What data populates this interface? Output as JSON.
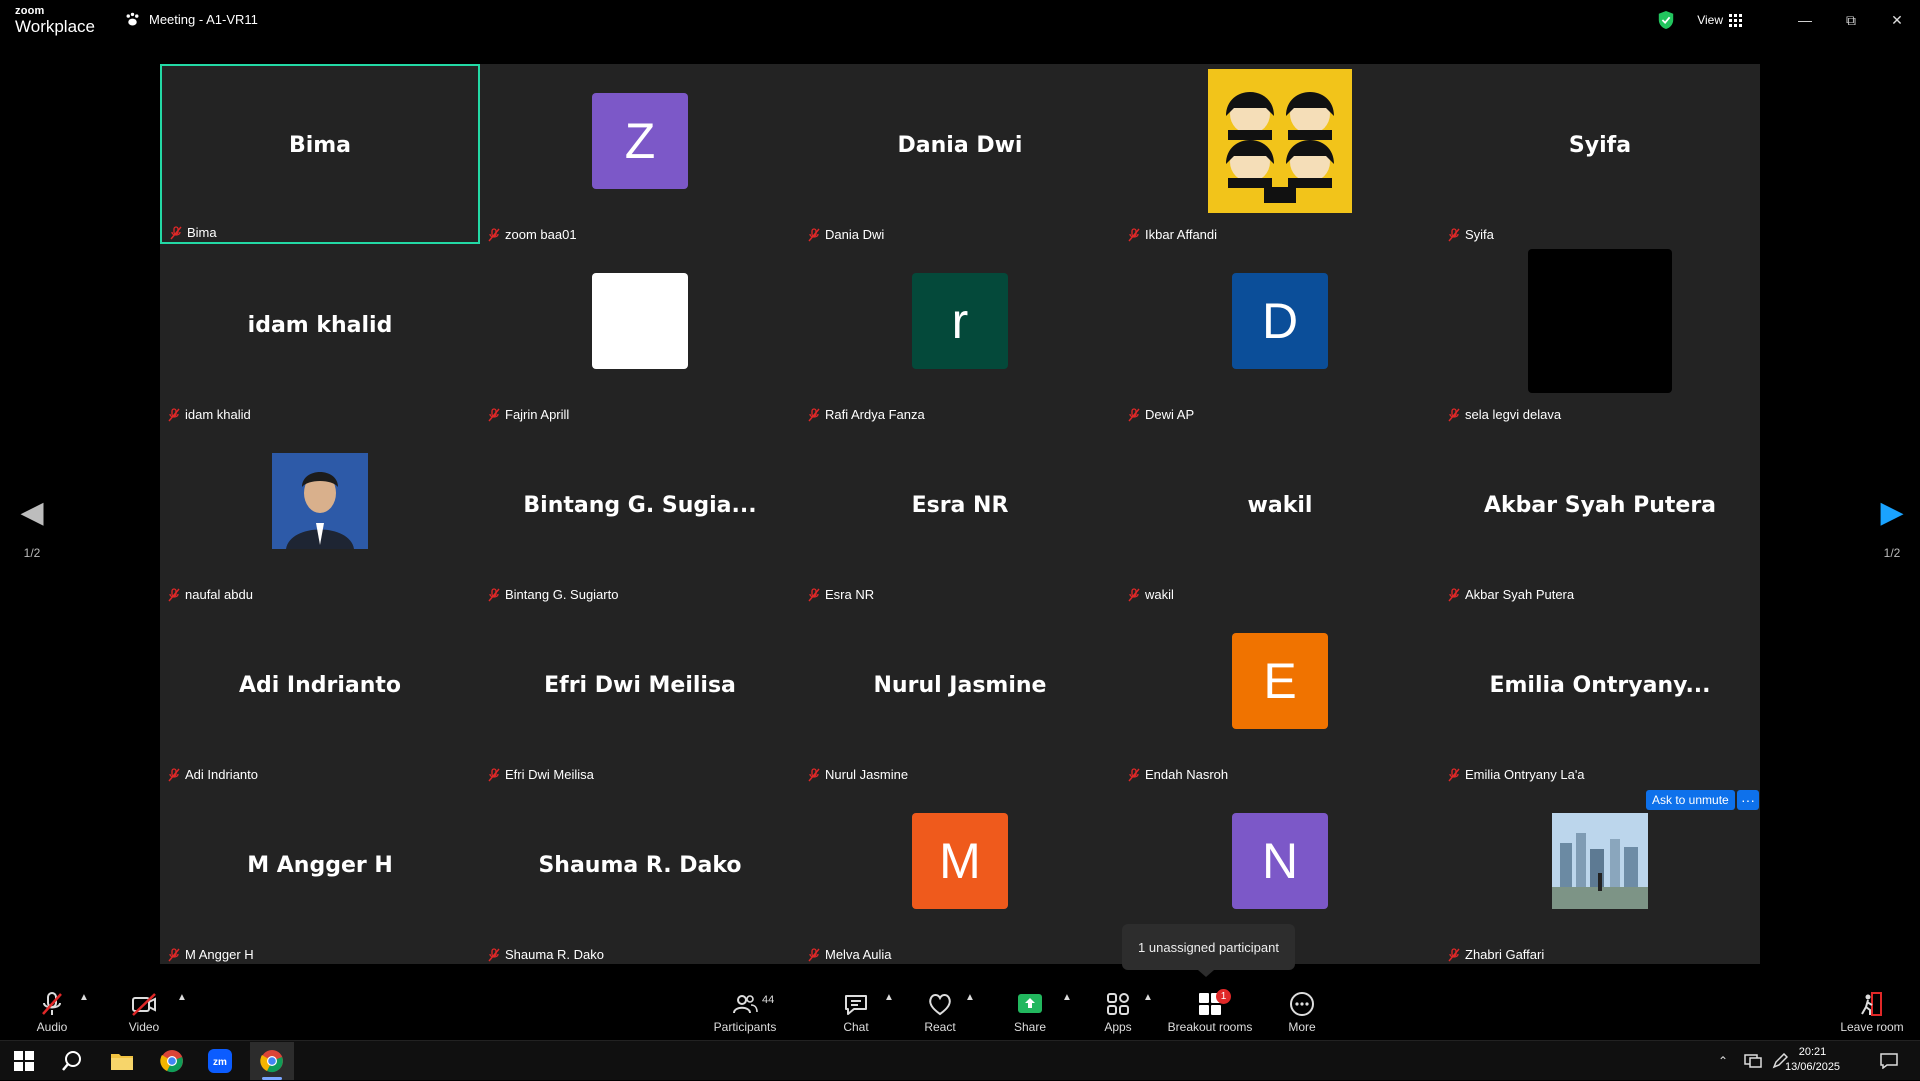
{
  "app": {
    "brand_small": "zoom",
    "brand_big": "Workplace",
    "meeting_title": "Meeting - A1-VR11",
    "view_label": "View"
  },
  "tiles": [
    {
      "display": "Bima",
      "label": "Bima",
      "active": true
    },
    {
      "display": "",
      "label": "zoom baa01",
      "avatar": "Z",
      "color": "#7c58c8"
    },
    {
      "display": "Dania Dwi",
      "label": "Dania Dwi"
    },
    {
      "display": "",
      "label": "Ikbar Affandi",
      "image": "beatles-cover",
      "color": "#f2c41a"
    },
    {
      "display": "Syifa",
      "label": "Syifa"
    },
    {
      "display": "idam khalid",
      "label": "idam khalid"
    },
    {
      "display": "",
      "label": "Fajrin Aprill",
      "avatar": "",
      "color": "#ffffff"
    },
    {
      "display": "",
      "label": "Rafi Ardya Fanza",
      "avatar": "r",
      "color": "#04493a"
    },
    {
      "display": "",
      "label": "Dewi AP",
      "avatar": "D",
      "color": "#0b4e99"
    },
    {
      "display": "",
      "label": "sela legvi delava",
      "avatar": "",
      "color": "#000000",
      "big": true
    },
    {
      "display": "",
      "label": "naufal abdu",
      "image": "portrait-photo",
      "color": "#2d5aa8"
    },
    {
      "display": "Bintang G. Sugia...",
      "label": "Bintang G. Sugiarto"
    },
    {
      "display": "Esra NR",
      "label": "Esra NR"
    },
    {
      "display": "wakil",
      "label": "wakil"
    },
    {
      "display": "Akbar Syah Putera",
      "label": "Akbar Syah Putera"
    },
    {
      "display": "Adi Indrianto",
      "label": "Adi Indrianto"
    },
    {
      "display": "Efri Dwi Meilisa",
      "label": "Efri Dwi Meilisa"
    },
    {
      "display": "Nurul Jasmine",
      "label": "Nurul Jasmine"
    },
    {
      "display": "",
      "label": "Endah Nasroh",
      "avatar": "E",
      "color": "#f07300"
    },
    {
      "display": "Emilia  Ontryany...",
      "label": "Emilia Ontryany La'a"
    },
    {
      "display": "M Angger H",
      "label": "M Angger H"
    },
    {
      "display": "Shauma R. Dako",
      "label": "Shauma R. Dako"
    },
    {
      "display": "",
      "label": "Melva Aulia",
      "avatar": "M",
      "color": "#ef5a1c"
    },
    {
      "display": "",
      "label": "",
      "avatar": "N",
      "color": "#7c58c8"
    },
    {
      "display": "",
      "label": "Zhabri Gaffari",
      "image": "city-photo",
      "color": "#8fb2cf"
    }
  ],
  "pager": {
    "left": "1/2",
    "right": "1/2"
  },
  "ask_unmute": "Ask to unmute",
  "more_dots": "···",
  "tooltip": "1 unassigned participant",
  "toolbar": {
    "audio": "Audio",
    "video": "Video",
    "participants": "Participants",
    "participants_count": "44",
    "chat": "Chat",
    "react": "React",
    "share": "Share",
    "apps": "Apps",
    "breakout": "Breakout rooms",
    "breakout_badge": "1",
    "more": "More",
    "leave": "Leave room"
  },
  "taskbar": {
    "time": "20:21",
    "date": "13/06/2025"
  },
  "colors": {
    "accent_green": "#23d9a5",
    "accent_blue": "#0e71eb",
    "share_green": "#22b75e",
    "tile_bg": "#232323",
    "mute_red": "#e02828"
  }
}
